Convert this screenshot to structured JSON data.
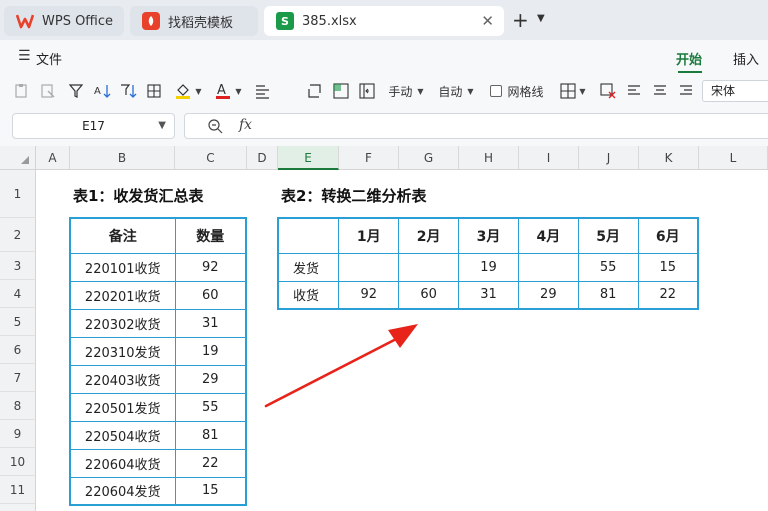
{
  "tabs": [
    {
      "label": "WPS Office",
      "icon": "wps-logo-icon",
      "active": false
    },
    {
      "label": "找稻壳模板",
      "icon": "docer-icon",
      "active": false
    },
    {
      "label": "385.xlsx",
      "icon": "spreadsheet-s-icon",
      "icon_text": "S",
      "active": true
    }
  ],
  "menu": {
    "file": "文件",
    "start": "开始",
    "insert": "插入"
  },
  "toolbar": {
    "manual": "手动",
    "auto": "自动",
    "gridlines": "网格线",
    "font": "宋体"
  },
  "formula": {
    "cell_ref": "E17",
    "fx": "fx",
    "value": ""
  },
  "colors": {
    "accent_green": "#1b7a3c",
    "table_border": "#2a9fd6",
    "font_red": "#e02020",
    "fill_yellow": "#f5d100"
  },
  "columns": [
    "A",
    "B",
    "C",
    "D",
    "E",
    "F",
    "G",
    "H",
    "I",
    "J",
    "K",
    "L"
  ],
  "rows": [
    "1",
    "2",
    "3",
    "4",
    "5",
    "6",
    "7",
    "8",
    "9",
    "10",
    "11"
  ],
  "table1": {
    "title": "表1：收发货汇总表",
    "headers": [
      "备注",
      "数量"
    ],
    "rows": [
      [
        "220101收货",
        "92"
      ],
      [
        "220201收货",
        "60"
      ],
      [
        "220302收货",
        "31"
      ],
      [
        "220310发货",
        "19"
      ],
      [
        "220403收货",
        "29"
      ],
      [
        "220501发货",
        "55"
      ],
      [
        "220504收货",
        "81"
      ],
      [
        "220604收货",
        "22"
      ],
      [
        "220604发货",
        "15"
      ]
    ]
  },
  "table2": {
    "title": "表2：转换二维分析表",
    "headers": [
      "",
      "1月",
      "2月",
      "3月",
      "4月",
      "5月",
      "6月"
    ],
    "rows": [
      [
        "发货",
        "",
        "",
        "19",
        "",
        "55",
        "15"
      ],
      [
        "收货",
        "92",
        "60",
        "31",
        "29",
        "81",
        "22"
      ]
    ]
  }
}
